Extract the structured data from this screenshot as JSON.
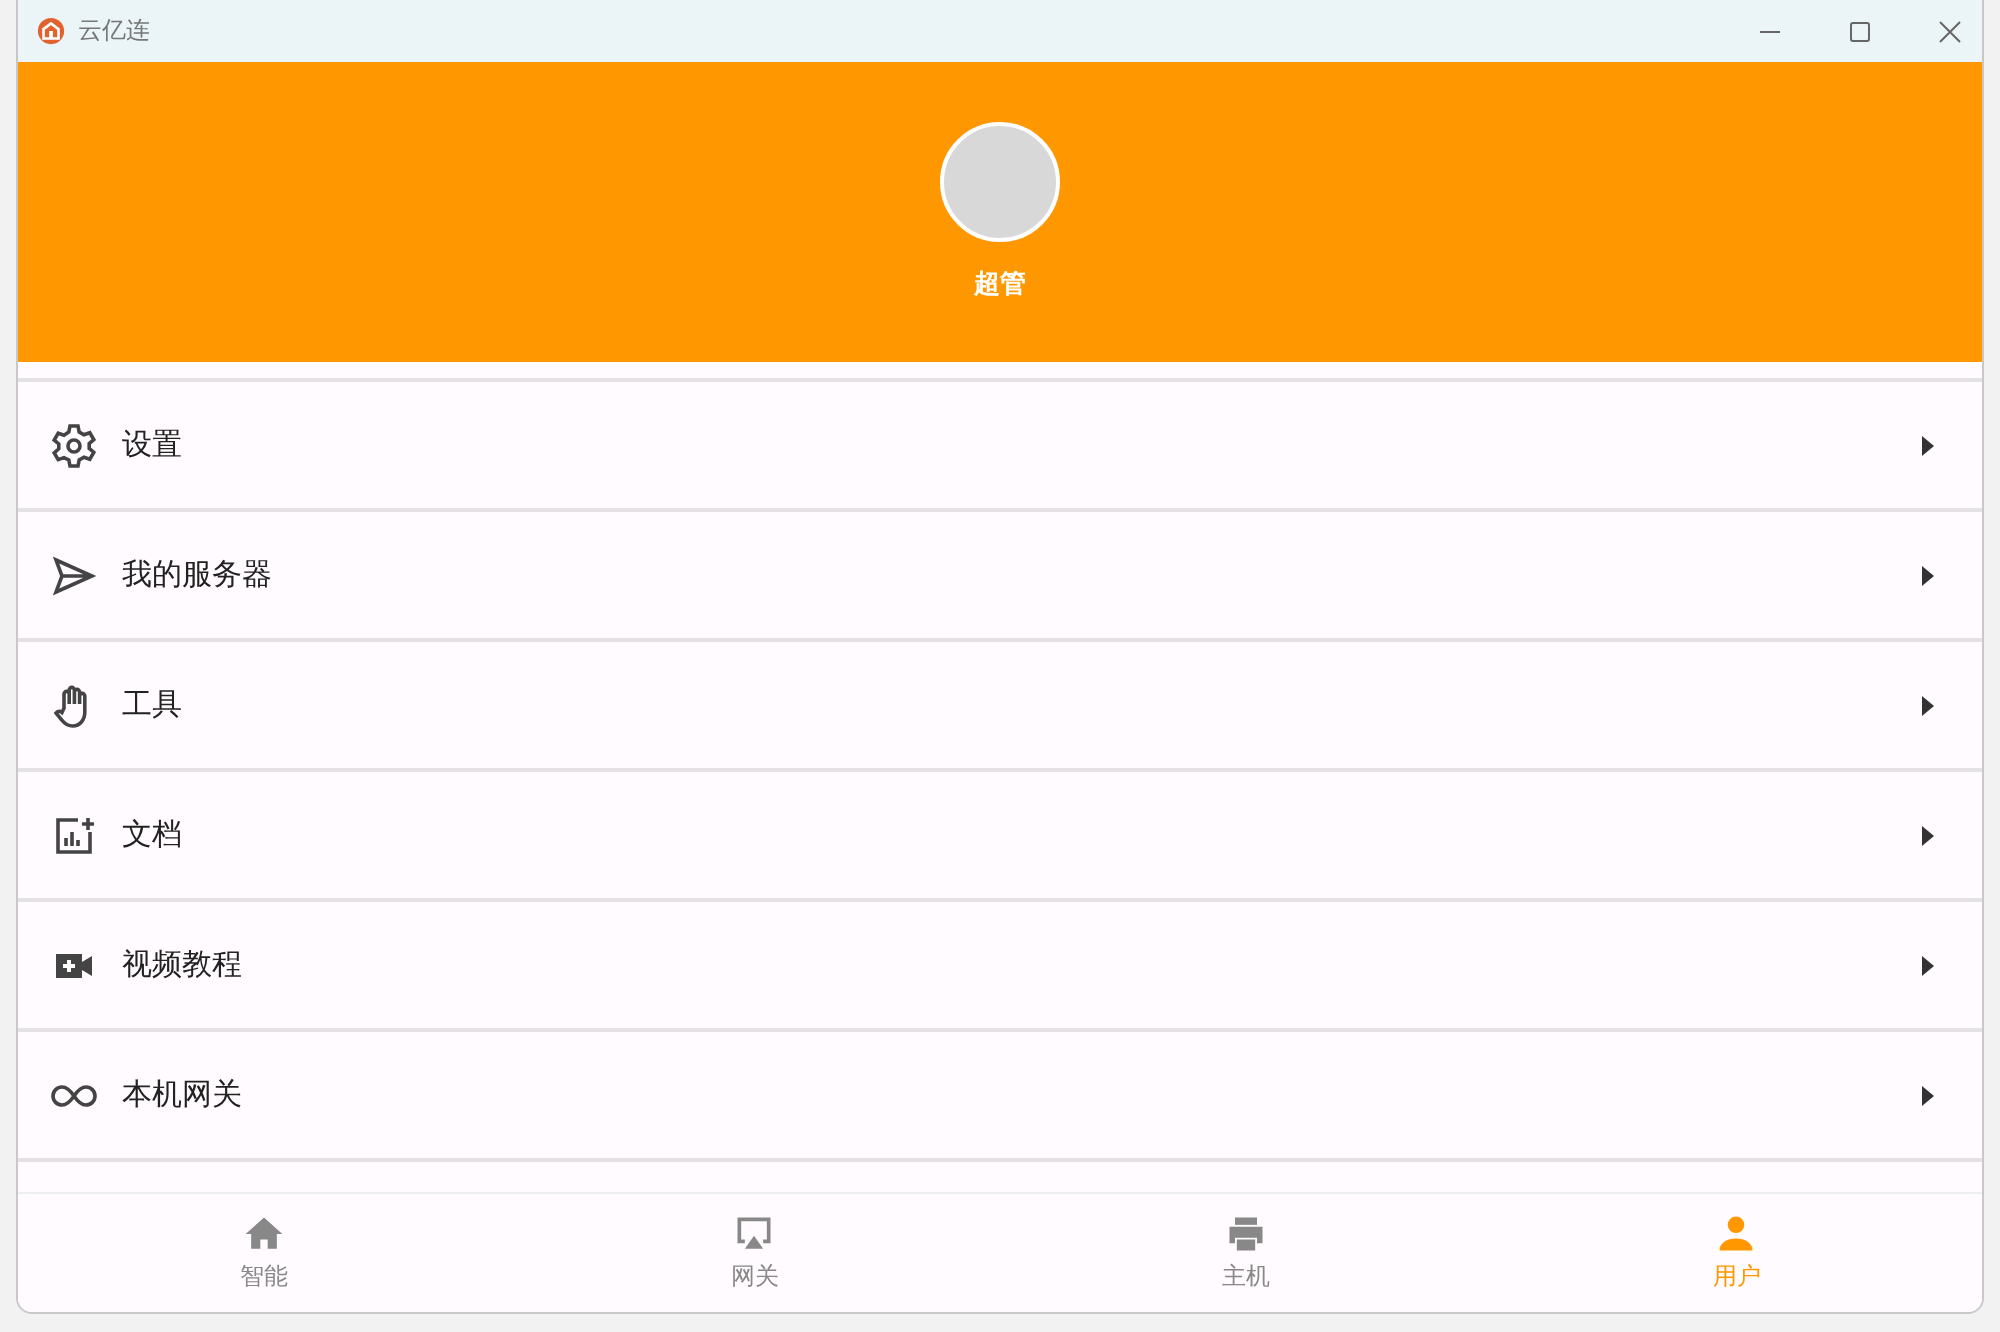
{
  "window": {
    "title": "云亿连"
  },
  "profile": {
    "name": "超管"
  },
  "menu": [
    {
      "label": "设置"
    },
    {
      "label": "我的服务器"
    },
    {
      "label": "工具"
    },
    {
      "label": "文档"
    },
    {
      "label": "视频教程"
    },
    {
      "label": "本机网关"
    }
  ],
  "bottom_nav": [
    {
      "label": "智能",
      "selected": false
    },
    {
      "label": "网关",
      "selected": false
    },
    {
      "label": "主机",
      "selected": false
    },
    {
      "label": "用户",
      "selected": true
    }
  ]
}
